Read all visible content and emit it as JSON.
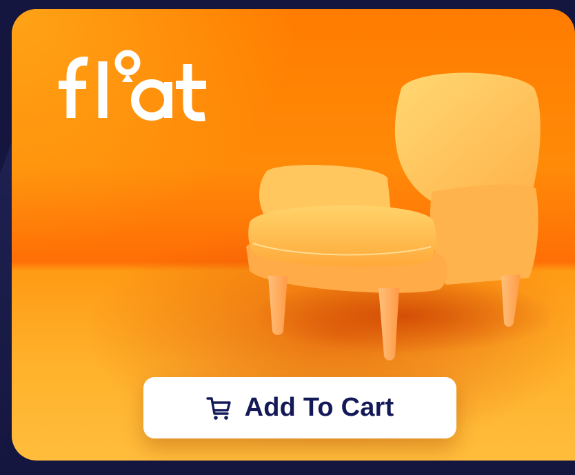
{
  "brand": {
    "logo_text": "float",
    "logo_color": "#ffffff"
  },
  "product": {
    "image_name": "armchair-image",
    "accent_color": "#ff7c00"
  },
  "cta": {
    "label": "Add To Cart",
    "icon": "cart-icon",
    "text_color": "#141a58"
  }
}
